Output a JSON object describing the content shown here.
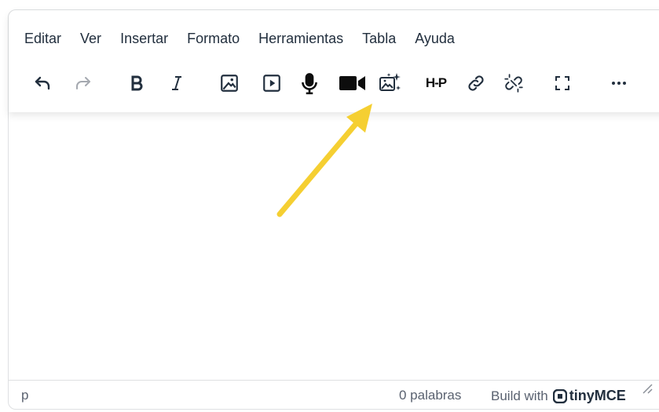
{
  "menubar": {
    "items": [
      "Editar",
      "Ver",
      "Insertar",
      "Formato",
      "Herramientas",
      "Tabla",
      "Ayuda"
    ]
  },
  "toolbar": {
    "h5p_label": "H-P",
    "buttons": [
      "undo-icon",
      "redo-icon",
      "bold-icon",
      "italic-icon",
      "image-icon",
      "media-icon",
      "microphone-icon",
      "video-camera-icon",
      "ai-image-icon",
      "h5p-icon",
      "link-icon",
      "unlink-icon",
      "fullscreen-icon",
      "more-icon"
    ]
  },
  "statusbar": {
    "path": "p",
    "word_count": "0 palabras",
    "build_with": "Build with",
    "brand": "tinyMCE"
  },
  "annotation": {
    "arrow_color": "#f5cf32"
  }
}
